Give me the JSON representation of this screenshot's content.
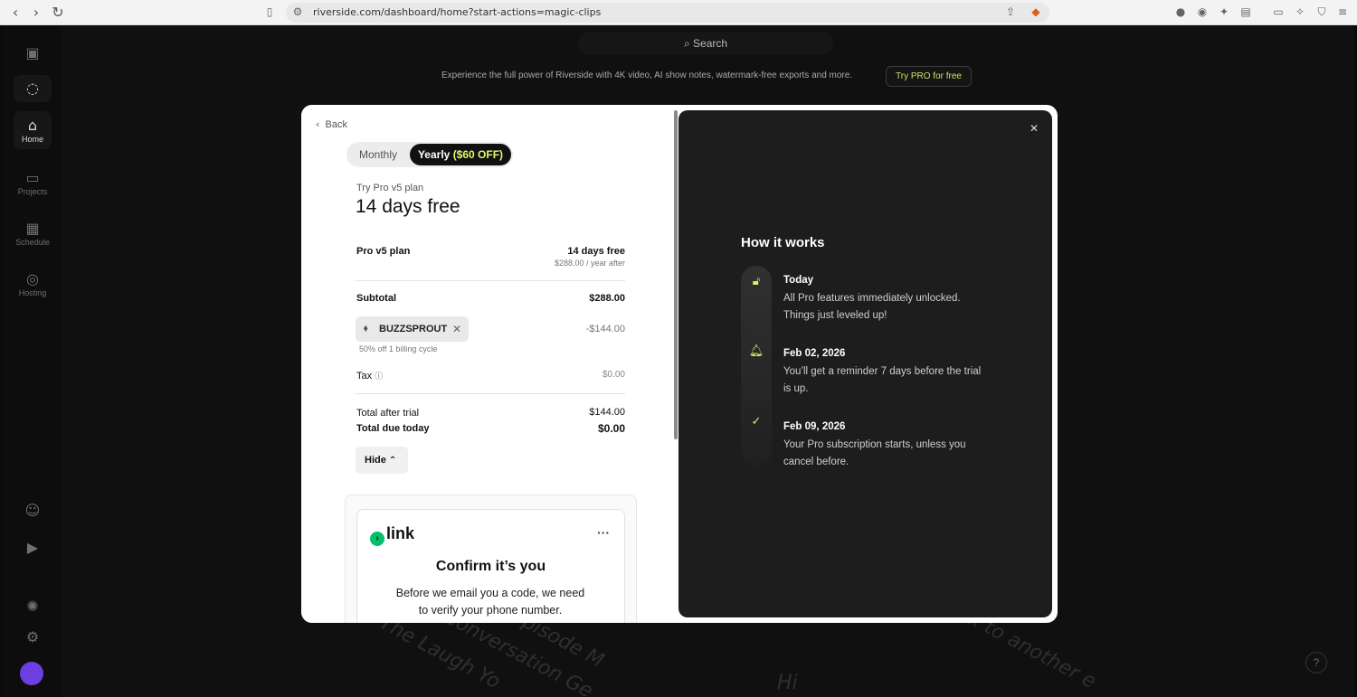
{
  "browser": {
    "url": "riverside.com/dashboard/home?start-actions=magic-clips"
  },
  "app": {
    "search_placeholder": "Search",
    "promo_text": "Experience the full power of Riverside with 4K video, AI show notes, watermark-free exports and more.",
    "promo_button": "Try PRO for free",
    "sidebar": [
      {
        "label": "Home",
        "icon": "home-icon"
      },
      {
        "label": "Projects",
        "icon": "folder-icon"
      },
      {
        "label": "Schedule",
        "icon": "calendar-icon"
      },
      {
        "label": "Hosting",
        "icon": "podcast-icon"
      }
    ],
    "background_texts": [
      "\"The Laugh Yo",
      "Conversation Ge",
      "pisode M",
      "ack to another e",
      "Hi"
    ],
    "help": "?"
  },
  "checkout": {
    "back": "Back",
    "billing_options": [
      "Monthly",
      "Yearly"
    ],
    "yearly_discount": "($60 OFF)",
    "plan_caption": "Try Pro v5 plan",
    "plan_headline": "14 days free",
    "plan_name": "Pro v5 plan",
    "plan_trial": "14 days free",
    "plan_after": "$288.00 / year after",
    "subtotal_label": "Subtotal",
    "subtotal_value": "$288.00",
    "coupon_code": "BUZZSPROUT",
    "coupon_discount": "-$144.00",
    "coupon_note": "50% off 1 billing cycle",
    "tax_label": "Tax",
    "tax_value": "$0.00",
    "total_after_label": "Total after trial",
    "total_after_value": "$144.00",
    "total_today_label": "Total due today",
    "total_today_value": "$0.00",
    "hide_button": "Hide",
    "link_logo": "link",
    "confirm_title": "Confirm it’s you",
    "confirm_body": "Before we email you a code, we need to verify your phone number."
  },
  "how_it_works": {
    "title": "How it works",
    "steps": [
      {
        "title": "Today",
        "body": "All Pro features immediately unlocked. Things just leveled up!",
        "icon": "unlock-icon"
      },
      {
        "title": "Feb 02, 2026",
        "body": "You’ll get a reminder 7 days before the trial is up.",
        "icon": "bell-icon"
      },
      {
        "title": "Feb 09, 2026",
        "body": "Your Pro subscription starts, unless you cancel before.",
        "icon": "check-circle-icon"
      }
    ]
  }
}
